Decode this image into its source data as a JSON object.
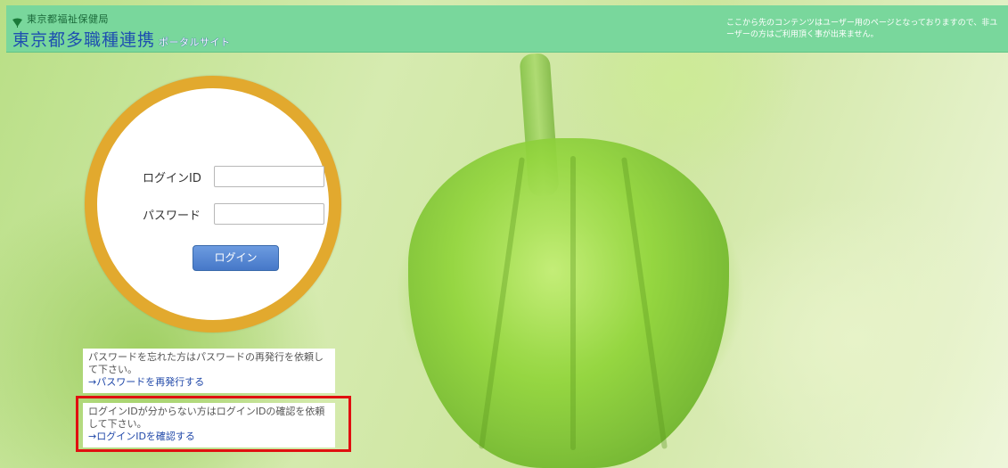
{
  "header": {
    "organization": "東京都福祉保健局",
    "title": "東京都多職種連携",
    "subtitle": "ポータルサイト",
    "notice": "ここから先のコンテンツはユーザー用のページとなっておりますので、非ユーザーの方はご利用頂く事が出来ません。"
  },
  "login": {
    "id_label": "ログインID",
    "id_value": "",
    "password_label": "パスワード",
    "password_value": "",
    "button_label": "ログイン"
  },
  "help": {
    "password_text": "パスワードを忘れた方はパスワードの再発行を依頼して下さい。",
    "password_link": "→パスワードを再発行する",
    "loginid_text": "ログインIDが分からない方はログインIDの確認を依頼して下さい。",
    "loginid_link": "→ログインIDを確認する"
  },
  "colors": {
    "header_bg": "#79d79c",
    "title": "#1e4fb0",
    "circle_ring": "#e2a92e",
    "button": "#4678c8",
    "highlight": "#e01010",
    "link": "#1f47a8"
  },
  "icons": {
    "org_logo": "ginkgo-leaf-icon"
  }
}
